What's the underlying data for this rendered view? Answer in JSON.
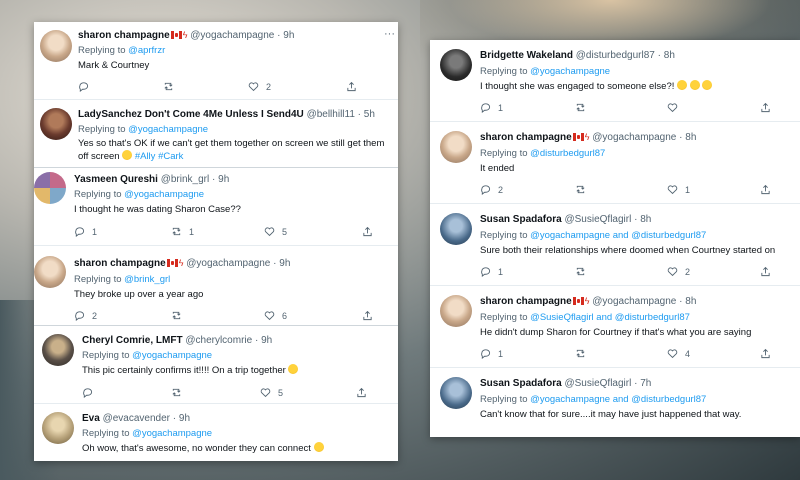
{
  "left_panel": {
    "tweets": [
      {
        "name": "sharon champagne",
        "handle": "@yogachampagne",
        "time": "9h",
        "replying_label": "Replying to ",
        "replying_to": "@aprfrzr",
        "text": "Mark & Courtney",
        "stats": {
          "reply": "",
          "retweet": "",
          "like": "2"
        },
        "avatar_color": "#c9a88a"
      },
      {
        "name": "LadySanchez Don't Come 4Me Unless I Send4U",
        "handle": "@bellhill11",
        "time": "5h",
        "replying_label": "Replying to ",
        "replying_to": "@yogachampagne",
        "text_line1": "Yes so that's OK if we can't get them together on screen we still get them",
        "text_line2_prefix": "off screen ",
        "hashtag1": "#Ally",
        "hashtag2": "#Cark",
        "avatar_color": "#6b3b2e"
      },
      {
        "name": "Yasmeen Qureshi",
        "handle": "@brink_grl",
        "time": "9h",
        "replying_label": "Replying to ",
        "replying_to": "@yogachampagne",
        "text": "I thought he was dating Sharon Case??",
        "stats": {
          "reply": "1",
          "retweet": "1",
          "like": "5"
        },
        "avatar_color": "#8a6fa8"
      },
      {
        "name": "sharon champagne",
        "handle": "@yogachampagne",
        "time": "9h",
        "replying_label": "Replying to ",
        "replying_to": "@brink_grl",
        "text": "They broke up over a year ago",
        "stats": {
          "reply": "2",
          "retweet": "",
          "like": "6"
        },
        "avatar_color": "#c9a88a"
      },
      {
        "name": "Cheryl Comrie, LMFT",
        "handle": "@cherylcomrie",
        "time": "9h",
        "replying_label": "Replying to ",
        "replying_to": "@yogachampagne",
        "text": "This pic certainly confirms it!!!! On a trip together",
        "stats": {
          "reply": "",
          "retweet": "",
          "like": "5"
        },
        "avatar_color": "#5a5048"
      },
      {
        "name": "Eva",
        "handle": "@evacavender",
        "time": "9h",
        "replying_label": "Replying to ",
        "replying_to": "@yogachampagne",
        "text": "Oh wow, that's awesome, no wonder they can connect",
        "avatar_color": "#b7a27a"
      }
    ]
  },
  "right_panel": {
    "tweets": [
      {
        "name": "Bridgette Wakeland",
        "handle": "@disturbedgurl87",
        "time": "8h",
        "replying_label": "Replying to ",
        "replying_to": "@yogachampagne",
        "text": "I thought she was engaged to someone else?!",
        "stats": {
          "reply": "1",
          "retweet": "",
          "like": ""
        },
        "avatar_color": "#2b2b2b"
      },
      {
        "name": "sharon champagne",
        "handle": "@yogachampagne",
        "time": "8h",
        "replying_label": "Replying to ",
        "replying_to": "@disturbedgurl87",
        "text": "It ended",
        "stats": {
          "reply": "2",
          "retweet": "",
          "like": "1"
        },
        "avatar_color": "#c9a88a"
      },
      {
        "name": "Susan Spadafora",
        "handle": "@SusieQflagirl",
        "time": "8h",
        "replying_label": "Replying to ",
        "replying_to": "@yogachampagne and @disturbedgurl87",
        "text": "Sure both their relationships where doomed when Courtney started on",
        "stats": {
          "reply": "1",
          "retweet": "",
          "like": "2"
        },
        "avatar_color": "#4a6a8a"
      },
      {
        "name": "sharon champagne",
        "handle": "@yogachampagne",
        "time": "8h",
        "replying_label": "Replying to ",
        "replying_to": "@SusieQflagirl and @disturbedgurl87",
        "text": "He didn't dump Sharon for Courtney if that's what you are saying",
        "stats": {
          "reply": "1",
          "retweet": "",
          "like": "4"
        },
        "avatar_color": "#c9a88a"
      },
      {
        "name": "Susan Spadafora",
        "handle": "@SusieQflagirl",
        "time": "7h",
        "replying_label": "Replying to ",
        "replying_to": "@yogachampagne and @disturbedgurl87",
        "text": "Can't know that for sure....it may have just happened that way.",
        "avatar_color": "#4a6a8a"
      }
    ]
  },
  "common": {
    "dot": "·",
    "more": "···"
  },
  "colors": {
    "link": "#1d9bf0",
    "muted": "#536471",
    "text": "#0f1419"
  }
}
